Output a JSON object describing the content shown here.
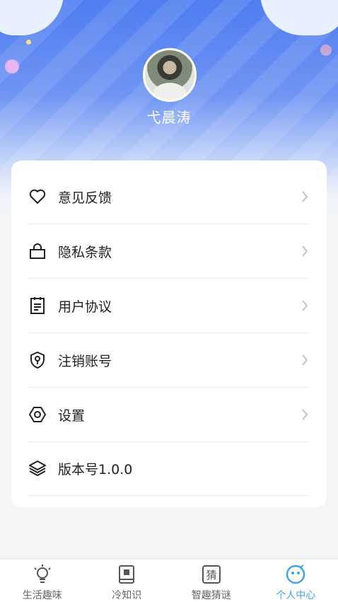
{
  "profile": {
    "username": "弋晨涛"
  },
  "menu": {
    "items": [
      {
        "label": "意见反馈",
        "icon": "heart-icon"
      },
      {
        "label": "隐私条款",
        "icon": "lock-icon"
      },
      {
        "label": "用户协议",
        "icon": "document-icon"
      },
      {
        "label": "注销账号",
        "icon": "shield-key-icon"
      },
      {
        "label": "设置",
        "icon": "hexagon-settings-icon"
      },
      {
        "label": "版本号1.0.0",
        "icon": "layers-icon"
      }
    ]
  },
  "tabbar": {
    "items": [
      {
        "label": "生活趣味",
        "icon": "lightbulb-icon"
      },
      {
        "label": "冷知识",
        "icon": "book-icon"
      },
      {
        "label": "智趣猜谜",
        "icon": "guess-icon",
        "glyph": "猜"
      },
      {
        "label": "个人中心",
        "icon": "face-icon"
      }
    ],
    "active_color": "#3aa4f0"
  }
}
